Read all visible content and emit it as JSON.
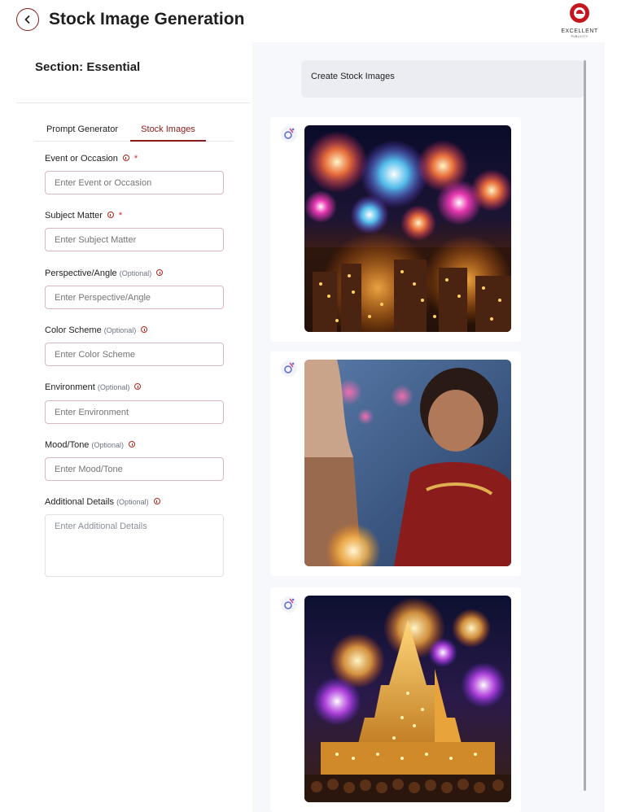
{
  "header": {
    "title": "Stock Image Generation",
    "logo_text": "EXCELLENT",
    "logo_sub": "PUBLICITY"
  },
  "sidebar": {
    "section_title": "Section: Essential",
    "tabs": [
      {
        "label": "Prompt Generator",
        "active": false
      },
      {
        "label": "Stock Images",
        "active": true
      }
    ],
    "fields": [
      {
        "label": "Event or Occasion",
        "optional": "",
        "required": true,
        "placeholder": "Enter Event or Occasion"
      },
      {
        "label": "Subject Matter",
        "optional": "",
        "required": true,
        "placeholder": "Enter Subject Matter"
      },
      {
        "label": "Perspective/Angle",
        "optional": "(Optional)",
        "required": false,
        "placeholder": "Enter Perspective/Angle"
      },
      {
        "label": "Color Scheme",
        "optional": "(Optional)",
        "required": false,
        "placeholder": "Enter Color Scheme"
      },
      {
        "label": "Environment",
        "optional": "(Optional)",
        "required": false,
        "placeholder": "Enter Environment"
      },
      {
        "label": "Mood/Tone",
        "optional": "(Optional)",
        "required": false,
        "placeholder": "Enter Mood/Tone"
      },
      {
        "label": "Additional Details",
        "optional": "(Optional)",
        "required": false,
        "placeholder": "Enter Additional Details"
      }
    ],
    "required_mark": "*"
  },
  "chat": {
    "user_message": "Create Stock Images",
    "images": [
      {
        "subject": "fireworks-over-city-at-night"
      },
      {
        "subject": "girls-with-sparklers"
      },
      {
        "subject": "illuminated-temple-with-fireworks"
      }
    ]
  },
  "colors": {
    "accent": "#8b1a1a",
    "panel_bg": "#f7f8fb",
    "bubble_bg": "#ebedf2",
    "required": "#dd2222"
  }
}
